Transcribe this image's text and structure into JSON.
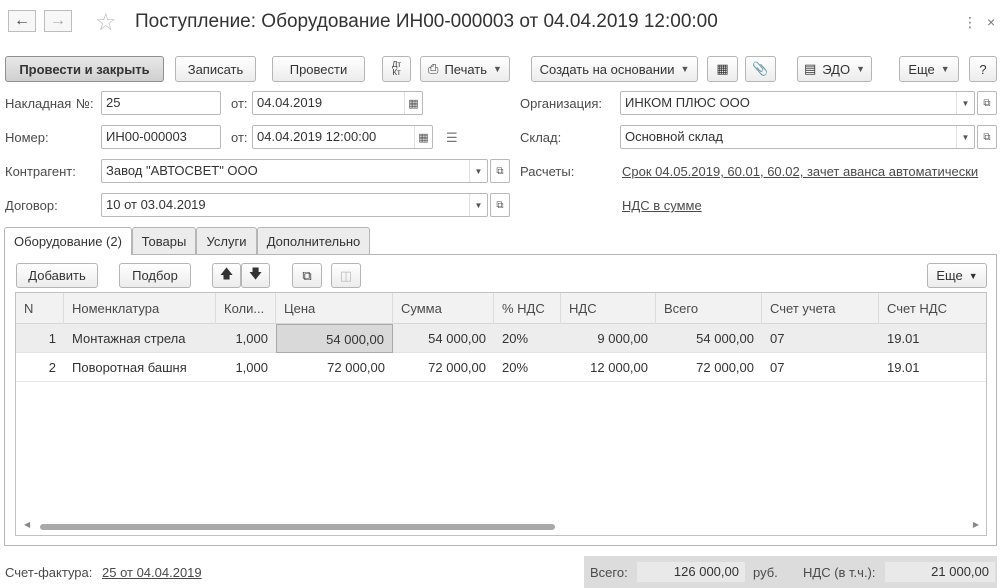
{
  "window": {
    "title": "Поступление: Оборудование ИН00-000003 от 04.04.2019 12:00:00",
    "back_icon": "arrow-left-icon",
    "forward_icon": "arrow-right-icon",
    "favorite_icon": "star-icon"
  },
  "toolbar": {
    "post_and_close": "Провести и закрыть",
    "save": "Записать",
    "post": "Провести",
    "dtkt_top": "Дт",
    "dtkt_bottom": "Кт",
    "print": "Печать",
    "create_based_on": "Создать на основании",
    "edo": "ЭДО",
    "more": "Еще",
    "help": "?"
  },
  "form": {
    "invoice_label": "Накладная",
    "invoice_no_label": "№:",
    "invoice_no": "25",
    "invoice_from_label": "от:",
    "invoice_date": "04.04.2019",
    "number_label": "Номер:",
    "number": "ИН00-000003",
    "number_from_label": "от:",
    "number_date": "04.04.2019 12:00:00",
    "counterparty_label": "Контрагент:",
    "counterparty": "Завод \"АВТОСВЕТ\" ООО",
    "contract_label": "Договор:",
    "contract": "10 от 03.04.2019",
    "organization_label": "Организация:",
    "organization": "ИНКОМ ПЛЮС ООО",
    "warehouse_label": "Склад:",
    "warehouse": "Основной склад",
    "settlements_label": "Расчеты:",
    "settlements_link": "Срок 04.05.2019, 60.01, 60.02, зачет аванса автоматически",
    "vat_link": "НДС в сумме"
  },
  "tabs": [
    {
      "label": "Оборудование (2)"
    },
    {
      "label": "Товары"
    },
    {
      "label": "Услуги"
    },
    {
      "label": "Дополнительно"
    }
  ],
  "table_toolbar": {
    "add": "Добавить",
    "pick": "Подбор",
    "more": "Еще"
  },
  "table": {
    "columns": [
      "N",
      "Номенклатура",
      "Коли...",
      "Цена",
      "Сумма",
      "% НДС",
      "НДС",
      "Всего",
      "Счет учета",
      "Счет НДС"
    ],
    "rows": [
      [
        "1",
        "Монтажная стрела",
        "1,000",
        "54 000,00",
        "54 000,00",
        "20%",
        "9 000,00",
        "54 000,00",
        "07",
        "19.01"
      ],
      [
        "2",
        "Поворотная башня",
        "1,000",
        "72 000,00",
        "72 000,00",
        "20%",
        "12 000,00",
        "72 000,00",
        "07",
        "19.01"
      ]
    ]
  },
  "footer": {
    "invoice_label": "Счет-фактура:",
    "invoice_link": "25 от 04.04.2019",
    "total_label": "Всего:",
    "total_value": "126 000,00",
    "currency": "руб.",
    "vat_label": "НДС (в т.ч.):",
    "vat_value": "21 000,00"
  }
}
